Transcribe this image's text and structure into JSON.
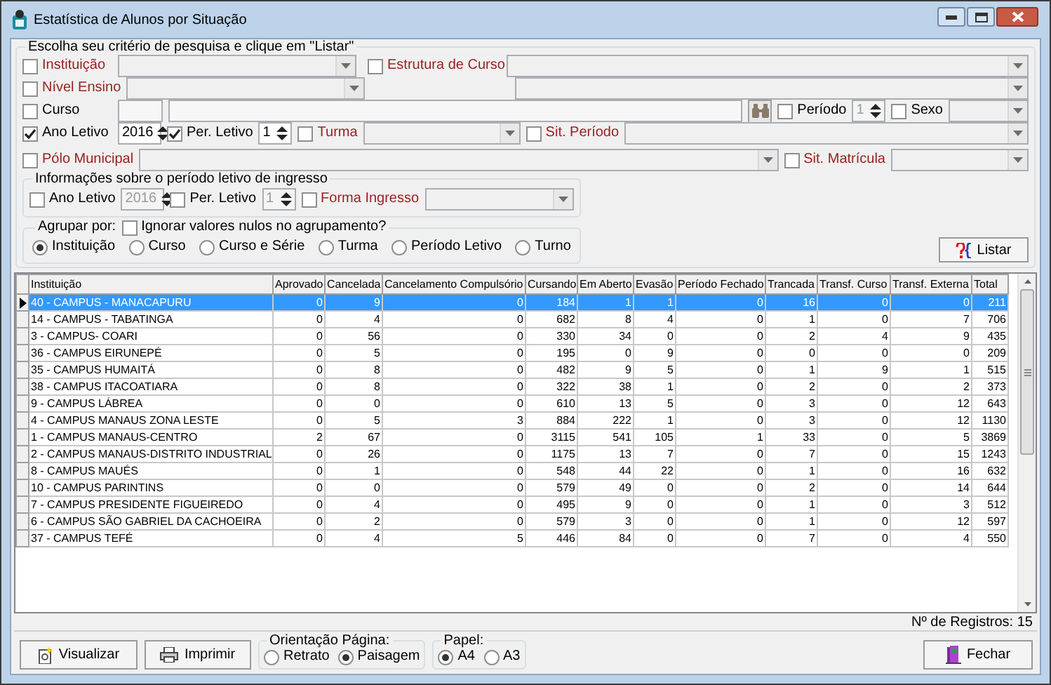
{
  "window": {
    "title": "Estatística de Alunos por Situação"
  },
  "criteria": {
    "title": "Escolha seu critério de pesquisa e clique em \"Listar\"",
    "lines": [
      {
        "items": [
          {
            "kind": "checkbox",
            "label": "Instituição",
            "checked": false,
            "emphasis": true
          },
          {
            "kind": "combo"
          },
          {
            "kind": "checkbox",
            "label": "Estrutura de Curso",
            "checked": false,
            "emphasis": true
          },
          {
            "kind": "combo"
          }
        ]
      },
      {
        "items": [
          {
            "kind": "checkbox",
            "label": "Nível Ensino",
            "checked": false,
            "emphasis": true
          },
          {
            "kind": "combo"
          },
          {
            "kind": "combo"
          }
        ]
      },
      {
        "items": [
          {
            "kind": "checkbox",
            "label": "Curso",
            "checked": false,
            "emphasis": false
          },
          {
            "kind": "text"
          },
          {
            "kind": "text"
          },
          {
            "kind": "find_button"
          },
          {
            "kind": "checkbox",
            "label": "Período",
            "checked": false,
            "emphasis": false
          },
          {
            "kind": "spin",
            "value": "1",
            "disabled": true
          },
          {
            "kind": "checkbox",
            "label": "Sexo",
            "checked": false,
            "emphasis": false
          },
          {
            "kind": "combo"
          }
        ]
      },
      {
        "items": [
          {
            "kind": "checkbox",
            "label": "Ano Letivo",
            "checked": true,
            "emphasis": false
          },
          {
            "kind": "spin",
            "value": "2016",
            "disabled": false
          },
          {
            "kind": "checkbox",
            "label": "Per. Letivo",
            "checked": true,
            "emphasis": false
          },
          {
            "kind": "spin",
            "value": "1",
            "disabled": false
          },
          {
            "kind": "checkbox",
            "label": "Turma",
            "checked": false,
            "emphasis": true
          },
          {
            "kind": "combo"
          },
          {
            "kind": "checkbox",
            "label": "Sit. Período",
            "checked": false,
            "emphasis": true
          },
          {
            "kind": "combo"
          }
        ]
      },
      {
        "items": [
          {
            "kind": "checkbox",
            "label": "Pólo Municipal",
            "checked": false,
            "emphasis": true
          },
          {
            "kind": "combo"
          },
          {
            "kind": "checkbox",
            "label": "Sit. Matrícula",
            "checked": false,
            "emphasis": true
          },
          {
            "kind": "combo"
          }
        ]
      }
    ]
  },
  "ingresso": {
    "title": "Informações sobre o período letivo de ingresso",
    "items": [
      {
        "kind": "checkbox",
        "label": "Ano Letivo",
        "checked": false,
        "emphasis": false
      },
      {
        "kind": "spin",
        "value": "2016",
        "disabled": true
      },
      {
        "kind": "checkbox",
        "label": "Per. Letivo",
        "checked": false,
        "emphasis": false
      },
      {
        "kind": "spin",
        "value": "1",
        "disabled": true
      },
      {
        "kind": "checkbox",
        "label": "Forma Ingresso",
        "checked": false,
        "emphasis": true
      },
      {
        "kind": "combo"
      }
    ]
  },
  "grouping": {
    "label": "Agrupar por:",
    "ignore_nulls": {
      "label": "Ignorar valores nulos no agrupamento?",
      "checked": false
    },
    "options": [
      {
        "label": "Instituição",
        "selected": true
      },
      {
        "label": "Curso",
        "selected": false
      },
      {
        "label": "Curso e Série",
        "selected": false
      },
      {
        "label": "Turma",
        "selected": false
      },
      {
        "label": "Período Letivo",
        "selected": false
      },
      {
        "label": "Turno",
        "selected": false
      }
    ]
  },
  "list_button": {
    "label": "Listar"
  },
  "table": {
    "columns": [
      "Instituição",
      "Aprovado",
      "Cancelada",
      "Cancelamento Compulsório",
      "Cursando",
      "Em Aberto",
      "Evasão",
      "Período Fechado",
      "Trancada",
      "Transf. Curso",
      "Transf. Externa",
      "Total"
    ],
    "rows": [
      {
        "selected": true,
        "cells": [
          "40 - CAMPUS - MANACAPURU",
          "0",
          "9",
          "0",
          "184",
          "1",
          "1",
          "0",
          "16",
          "0",
          "0",
          "211"
        ]
      },
      {
        "selected": false,
        "cells": [
          "14 - CAMPUS - TABATINGA",
          "0",
          "4",
          "0",
          "682",
          "8",
          "4",
          "0",
          "1",
          "0",
          "7",
          "706"
        ]
      },
      {
        "selected": false,
        "cells": [
          "3 - CAMPUS- COARI",
          "0",
          "56",
          "0",
          "330",
          "34",
          "0",
          "0",
          "2",
          "4",
          "9",
          "435"
        ]
      },
      {
        "selected": false,
        "cells": [
          "36 - CAMPUS EIRUNEPÉ",
          "0",
          "5",
          "0",
          "195",
          "0",
          "9",
          "0",
          "0",
          "0",
          "0",
          "209"
        ]
      },
      {
        "selected": false,
        "cells": [
          "35 - CAMPUS HUMAITÁ",
          "0",
          "8",
          "0",
          "482",
          "9",
          "5",
          "0",
          "1",
          "9",
          "1",
          "515"
        ]
      },
      {
        "selected": false,
        "cells": [
          "38 - CAMPUS ITACOATIARA",
          "0",
          "8",
          "0",
          "322",
          "38",
          "1",
          "0",
          "2",
          "0",
          "2",
          "373"
        ]
      },
      {
        "selected": false,
        "cells": [
          "9 - CAMPUS LÁBREA",
          "0",
          "0",
          "0",
          "610",
          "13",
          "5",
          "0",
          "3",
          "0",
          "12",
          "643"
        ]
      },
      {
        "selected": false,
        "cells": [
          "4 - CAMPUS MANAUS ZONA LESTE",
          "0",
          "5",
          "3",
          "884",
          "222",
          "1",
          "0",
          "3",
          "0",
          "12",
          "1130"
        ]
      },
      {
        "selected": false,
        "cells": [
          "1 - CAMPUS MANAUS-CENTRO",
          "2",
          "67",
          "0",
          "3115",
          "541",
          "105",
          "1",
          "33",
          "0",
          "5",
          "3869"
        ]
      },
      {
        "selected": false,
        "cells": [
          "2 - CAMPUS MANAUS-DISTRITO INDUSTRIAL",
          "0",
          "26",
          "0",
          "1175",
          "13",
          "7",
          "0",
          "7",
          "0",
          "15",
          "1243"
        ]
      },
      {
        "selected": false,
        "cells": [
          "8 - CAMPUS MAUÉS",
          "0",
          "1",
          "0",
          "548",
          "44",
          "22",
          "0",
          "1",
          "0",
          "16",
          "632"
        ]
      },
      {
        "selected": false,
        "cells": [
          "10 - CAMPUS PARINTINS",
          "0",
          "0",
          "0",
          "579",
          "49",
          "0",
          "0",
          "2",
          "0",
          "14",
          "644"
        ]
      },
      {
        "selected": false,
        "cells": [
          "7 - CAMPUS PRESIDENTE FIGUEIREDO",
          "0",
          "4",
          "0",
          "495",
          "9",
          "0",
          "0",
          "1",
          "0",
          "3",
          "512"
        ]
      },
      {
        "selected": false,
        "cells": [
          "6 - CAMPUS SÃO GABRIEL DA CACHOEIRA",
          "0",
          "2",
          "0",
          "579",
          "3",
          "0",
          "0",
          "1",
          "0",
          "12",
          "597"
        ]
      },
      {
        "selected": false,
        "cells": [
          "37 - CAMPUS TEFÉ",
          "0",
          "4",
          "5",
          "446",
          "84",
          "0",
          "0",
          "7",
          "0",
          "4",
          "550"
        ]
      }
    ]
  },
  "record_count": "Nº de Registros: 15",
  "actions": {
    "preview": {
      "label": "Visualizar"
    },
    "print": {
      "label": "Imprimir"
    },
    "orientation": {
      "title": "Orientação Página:",
      "options": [
        {
          "label": "Retrato",
          "selected": false
        },
        {
          "label": "Paisagem",
          "selected": true
        }
      ]
    },
    "paper": {
      "title": "Papel:",
      "options": [
        {
          "label": "A4",
          "selected": true
        },
        {
          "label": "A3",
          "selected": false
        }
      ]
    },
    "close": {
      "label": "Fechar"
    }
  }
}
